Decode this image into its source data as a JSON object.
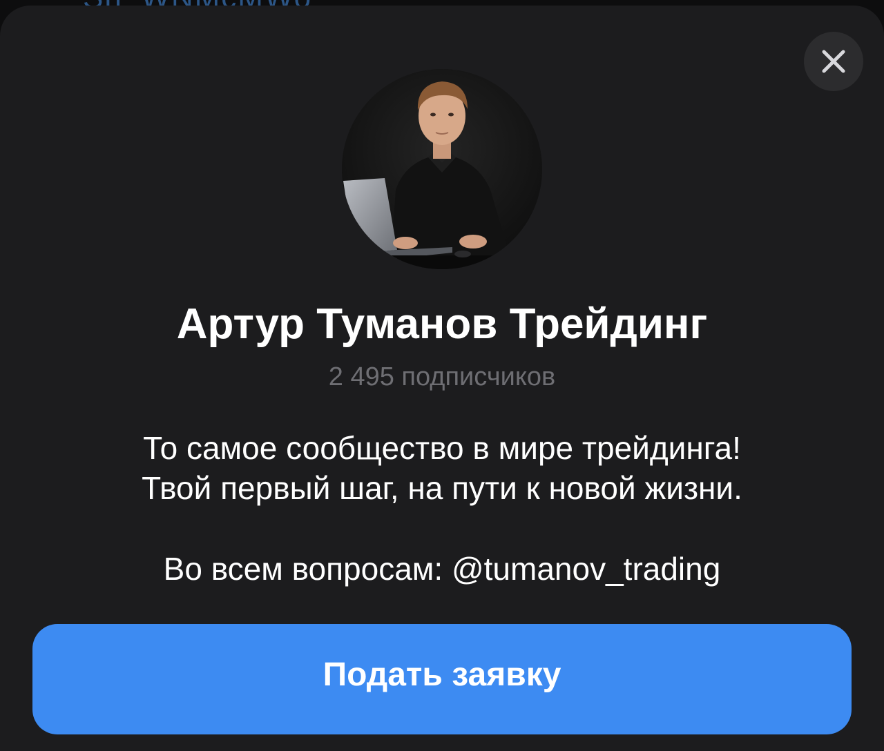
{
  "backdrop": {
    "peek_text": "Sh_WNMcMWo"
  },
  "channel": {
    "name": "Артур Туманов Трейдинг",
    "subscribers": "2 495 подписчиков",
    "description_lines": [
      "То самое сообщество в мире трейдинга!",
      "Твой первый шаг, на пути к новой жизни."
    ],
    "contact": "Во всем вопросам: @tumanov_trading"
  },
  "actions": {
    "apply_label": "Подать заявку"
  },
  "icons": {
    "close": "close-icon",
    "avatar": "avatar-photo"
  },
  "colors": {
    "sheet_bg": "#1c1c1e",
    "button_blue": "#3d8bf2",
    "muted_text": "#6e6e73",
    "close_bg": "#2c2c2e"
  }
}
